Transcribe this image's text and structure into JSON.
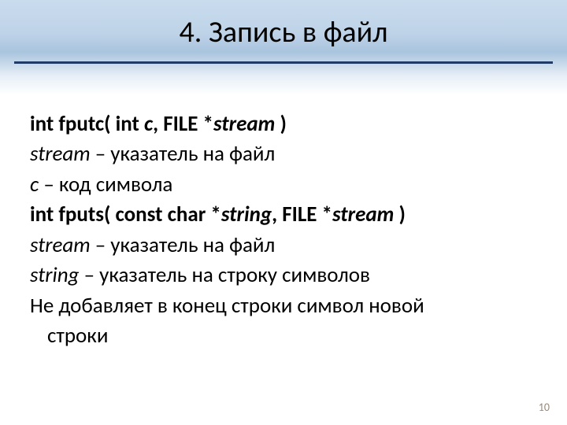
{
  "title": "4. Запись в файл",
  "lines": {
    "l1": {
      "b1": "int fputc( int ",
      "i1": "c",
      "t1": ", ",
      "b2": "FILE *",
      "i2": "stream ",
      "b3": ")"
    },
    "l2": {
      "i1": "stream",
      "t1": " – указатель на файл"
    },
    "l3": {
      "i1": "c",
      "t1": " – код символа"
    },
    "l4": {
      "b1": "int fputs( const char *",
      "i1": "string",
      "t1": ", ",
      "b2": "FILE *",
      "i2": "stream ",
      "b3": ")"
    },
    "l5": {
      "i1": "stream",
      "t1": " – указатель на файл"
    },
    "l6": {
      "i1": "string",
      "t1": " – указатель на строку символов"
    },
    "l7": {
      "t1": "Не добавляет в конец строки символ новой"
    },
    "l8": {
      "t1": "строки"
    }
  },
  "page_number": "10"
}
